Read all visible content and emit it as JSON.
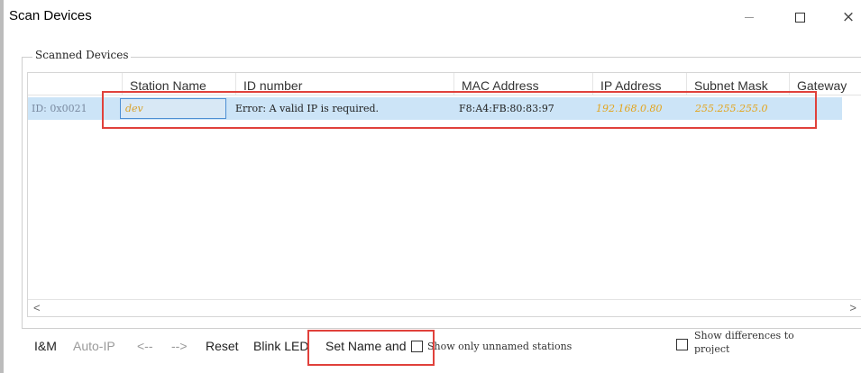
{
  "window": {
    "title": "Scan Devices",
    "minimize_icon": "minimize-icon",
    "maximize_icon": "maximize-icon",
    "close_glyph": "×"
  },
  "group": {
    "title": "Scanned Devices"
  },
  "table": {
    "columns": [
      "Station Name",
      "ID number",
      "MAC Address",
      "IP Address",
      "Subnet Mask",
      "Gateway"
    ],
    "rows": [
      {
        "id": "ID: 0x0021",
        "station_name": "dev",
        "id_number": "Error: A valid IP is required.",
        "mac": "F8:A4:FB:80:83:97",
        "ip": "192.168.0.80",
        "subnet": "255.255.255.0",
        "gateway": ""
      }
    ],
    "selected_row_color": "#cce4f7",
    "warn_value_color": "#e3a41c"
  },
  "scrollbar": {
    "left_arrow": "<",
    "right_arrow": ">"
  },
  "toolbar": {
    "im": "I&M",
    "auto_ip": "Auto-IP",
    "prev": "<--",
    "next": "-->",
    "reset": "Reset",
    "blink": "Blink LED",
    "set_name": "Set Name and",
    "show_unnamed": "Show only unnamed stations",
    "show_diff_line1": "Show differences to",
    "show_diff_line2": "project"
  },
  "annotation_color": "#e0413b"
}
